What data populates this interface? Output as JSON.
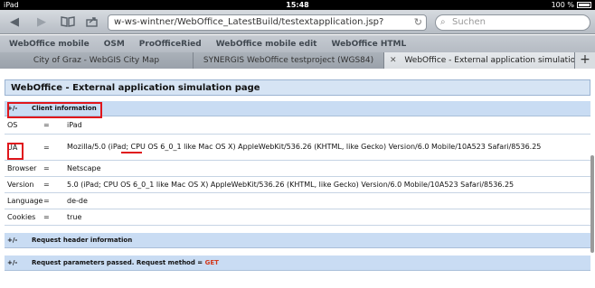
{
  "status": {
    "left": "iPad",
    "time": "15:48",
    "battery": "100 %"
  },
  "toolbar": {
    "url": "w-ws-wintner/WebOffice_LatestBuild/testextapplication.jsp?",
    "search_placeholder": "Suchen"
  },
  "bookmarks": [
    "WebOffice mobile",
    "OSM",
    "ProOfficeRied",
    "WebOffice mobile edit",
    "WebOffice HTML"
  ],
  "tabs": [
    {
      "label": "City of Graz - WebGIS City Map"
    },
    {
      "label": "SYNERGIS WebOffice testproject (WGS84)"
    },
    {
      "label": "WebOffice - External application simulation..."
    }
  ],
  "page": {
    "title": "WebOffice - External application simulation page",
    "client_section": {
      "toggle": "+/-",
      "label": "Client information"
    },
    "rows": [
      {
        "key": "OS",
        "eq": "=",
        "value": "iPad"
      },
      {
        "key": "UA",
        "eq": "=",
        "value": "Mozilla/5.0 (iPad; CPU OS 6_0_1 like Mac OS X) AppleWebKit/536.26 (KHTML, like Gecko) Version/6.0 Mobile/10A523 Safari/8536.25"
      },
      {
        "key": "Browser",
        "eq": "=",
        "value": "Netscape"
      },
      {
        "key": "Version",
        "eq": "=",
        "value": "5.0 (iPad; CPU OS 6_0_1 like Mac OS X) AppleWebKit/536.26 (KHTML, like Gecko) Version/6.0 Mobile/10A523 Safari/8536.25"
      },
      {
        "key": "Language",
        "eq": "=",
        "value": "de-de"
      },
      {
        "key": "Cookies",
        "eq": "=",
        "value": "true"
      }
    ],
    "request_header_section": {
      "toggle": "+/-",
      "label": "Request header information"
    },
    "request_params_section": {
      "toggle": "+/-",
      "label": "Request parameters passed. Request method = ",
      "method": "GET"
    }
  },
  "colors": {
    "accent_red": "#e0161c",
    "section_bg": "#c9dcf3",
    "method_red": "#d23a1e"
  },
  "icons": {
    "back": "back-arrow-icon",
    "forward": "forward-arrow-icon",
    "bookmarks": "bookmarks-book-icon",
    "share": "share-icon",
    "reload": "reload-icon",
    "search": "search-icon",
    "add_tab": "plus-icon"
  }
}
